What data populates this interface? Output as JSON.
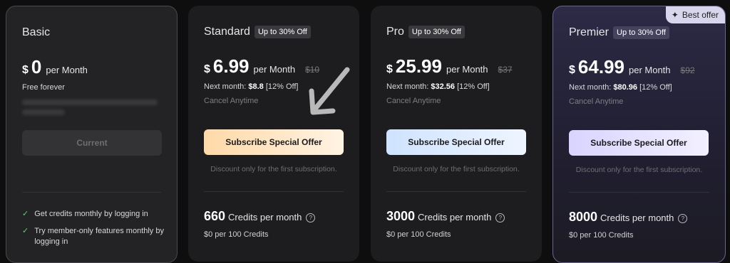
{
  "basic": {
    "name": "Basic",
    "currency": "$",
    "amount": "0",
    "period": "per Month",
    "note": "Free forever",
    "button": "Current",
    "features": [
      "Get credits monthly by logging in",
      "Try member-only features monthly by logging in"
    ]
  },
  "standard": {
    "name": "Standard",
    "badge": "Up to 30% Off",
    "currency": "$",
    "amount": "6.99",
    "period": "per Month",
    "old_price": "$10",
    "next_prefix": "Next month: ",
    "next_value": "$8.8",
    "next_suffix": " [12% Off]",
    "cancel": "Cancel Anytime",
    "button": "Subscribe Special Offer",
    "discount_note": "Discount only for the first subscription.",
    "credits": "660",
    "credits_label": "Credits per month",
    "per_credit": "$0 per 100 Credits"
  },
  "pro": {
    "name": "Pro",
    "badge": "Up to 30% Off",
    "currency": "$",
    "amount": "25.99",
    "period": "per Month",
    "old_price": "$37",
    "next_prefix": "Next month: ",
    "next_value": "$32.56",
    "next_suffix": " [12% Off]",
    "cancel": "Cancel Anytime",
    "button": "Subscribe Special Offer",
    "discount_note": "Discount only for the first subscription.",
    "credits": "3000",
    "credits_label": "Credits per month",
    "per_credit": "$0 per 100 Credits"
  },
  "premier": {
    "name": "Premier",
    "badge": "Up to 30% Off",
    "best_offer": "Best offer",
    "currency": "$",
    "amount": "64.99",
    "period": "per Month",
    "old_price": "$92",
    "next_prefix": "Next month: ",
    "next_value": "$80.96",
    "next_suffix": " [12% Off]",
    "cancel": "Cancel Anytime",
    "button": "Subscribe Special Offer",
    "discount_note": "Discount only for the first subscription.",
    "credits": "8000",
    "credits_label": "Credits per month",
    "per_credit": "$0 per 100 Credits"
  },
  "icons": {
    "help": "?",
    "check": "✓",
    "sparkle": "✦"
  },
  "colors": {
    "check": "#5fd07a",
    "standard_button": "#ffd9a8",
    "pro_button": "#cfe3ff",
    "premier_button": "#d9d4ff"
  }
}
